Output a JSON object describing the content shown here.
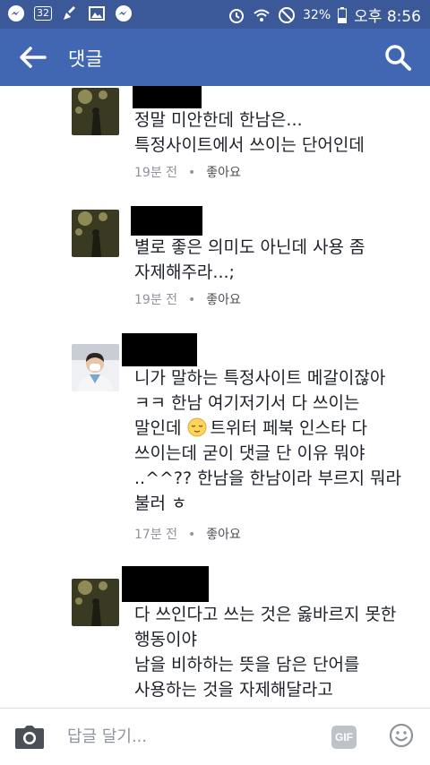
{
  "status_bar": {
    "notification_count": "32",
    "battery": "32%",
    "time": "오후 8:56"
  },
  "header": {
    "title": "댓글"
  },
  "comments": [
    {
      "lines": [
        "정말 미안한데 한남은...",
        "특정사이트에서 쓰이는 단어인데"
      ],
      "time": "19분 전",
      "like": "좋아요"
    },
    {
      "lines": [
        "별로 좋은 의미도 아닌데 사용 좀",
        "자제해주라...;"
      ],
      "time": "19분 전",
      "like": "좋아요"
    },
    {
      "lines": [
        "니가 말하는 특정사이트 메갈이잖아",
        "ㅋㅋ 한남 여기저기서 다 쓰이는",
        "말인데",
        "트위터 페북 인스타 다",
        "쓰이는데 굳이 댓글 단 이유 뭐야",
        "..^^?? 한남을 한남이라 부르지 뭐라",
        "불러 ㅎ"
      ],
      "time": "17분 전",
      "like": "좋아요"
    },
    {
      "lines": [
        "다 쓰인다고 쓰는 것은 옳바르지 못한",
        "행동이야",
        "남을 비하하는 뜻을 담은 단어를",
        "사용하는 것을 자제해달라고"
      ]
    }
  ],
  "composer": {
    "placeholder": "답글 달기...",
    "gif_label": "GIF"
  },
  "colors": {
    "status_bar": "#3b5998",
    "header": "#4267b2",
    "meta": "#90949c"
  }
}
